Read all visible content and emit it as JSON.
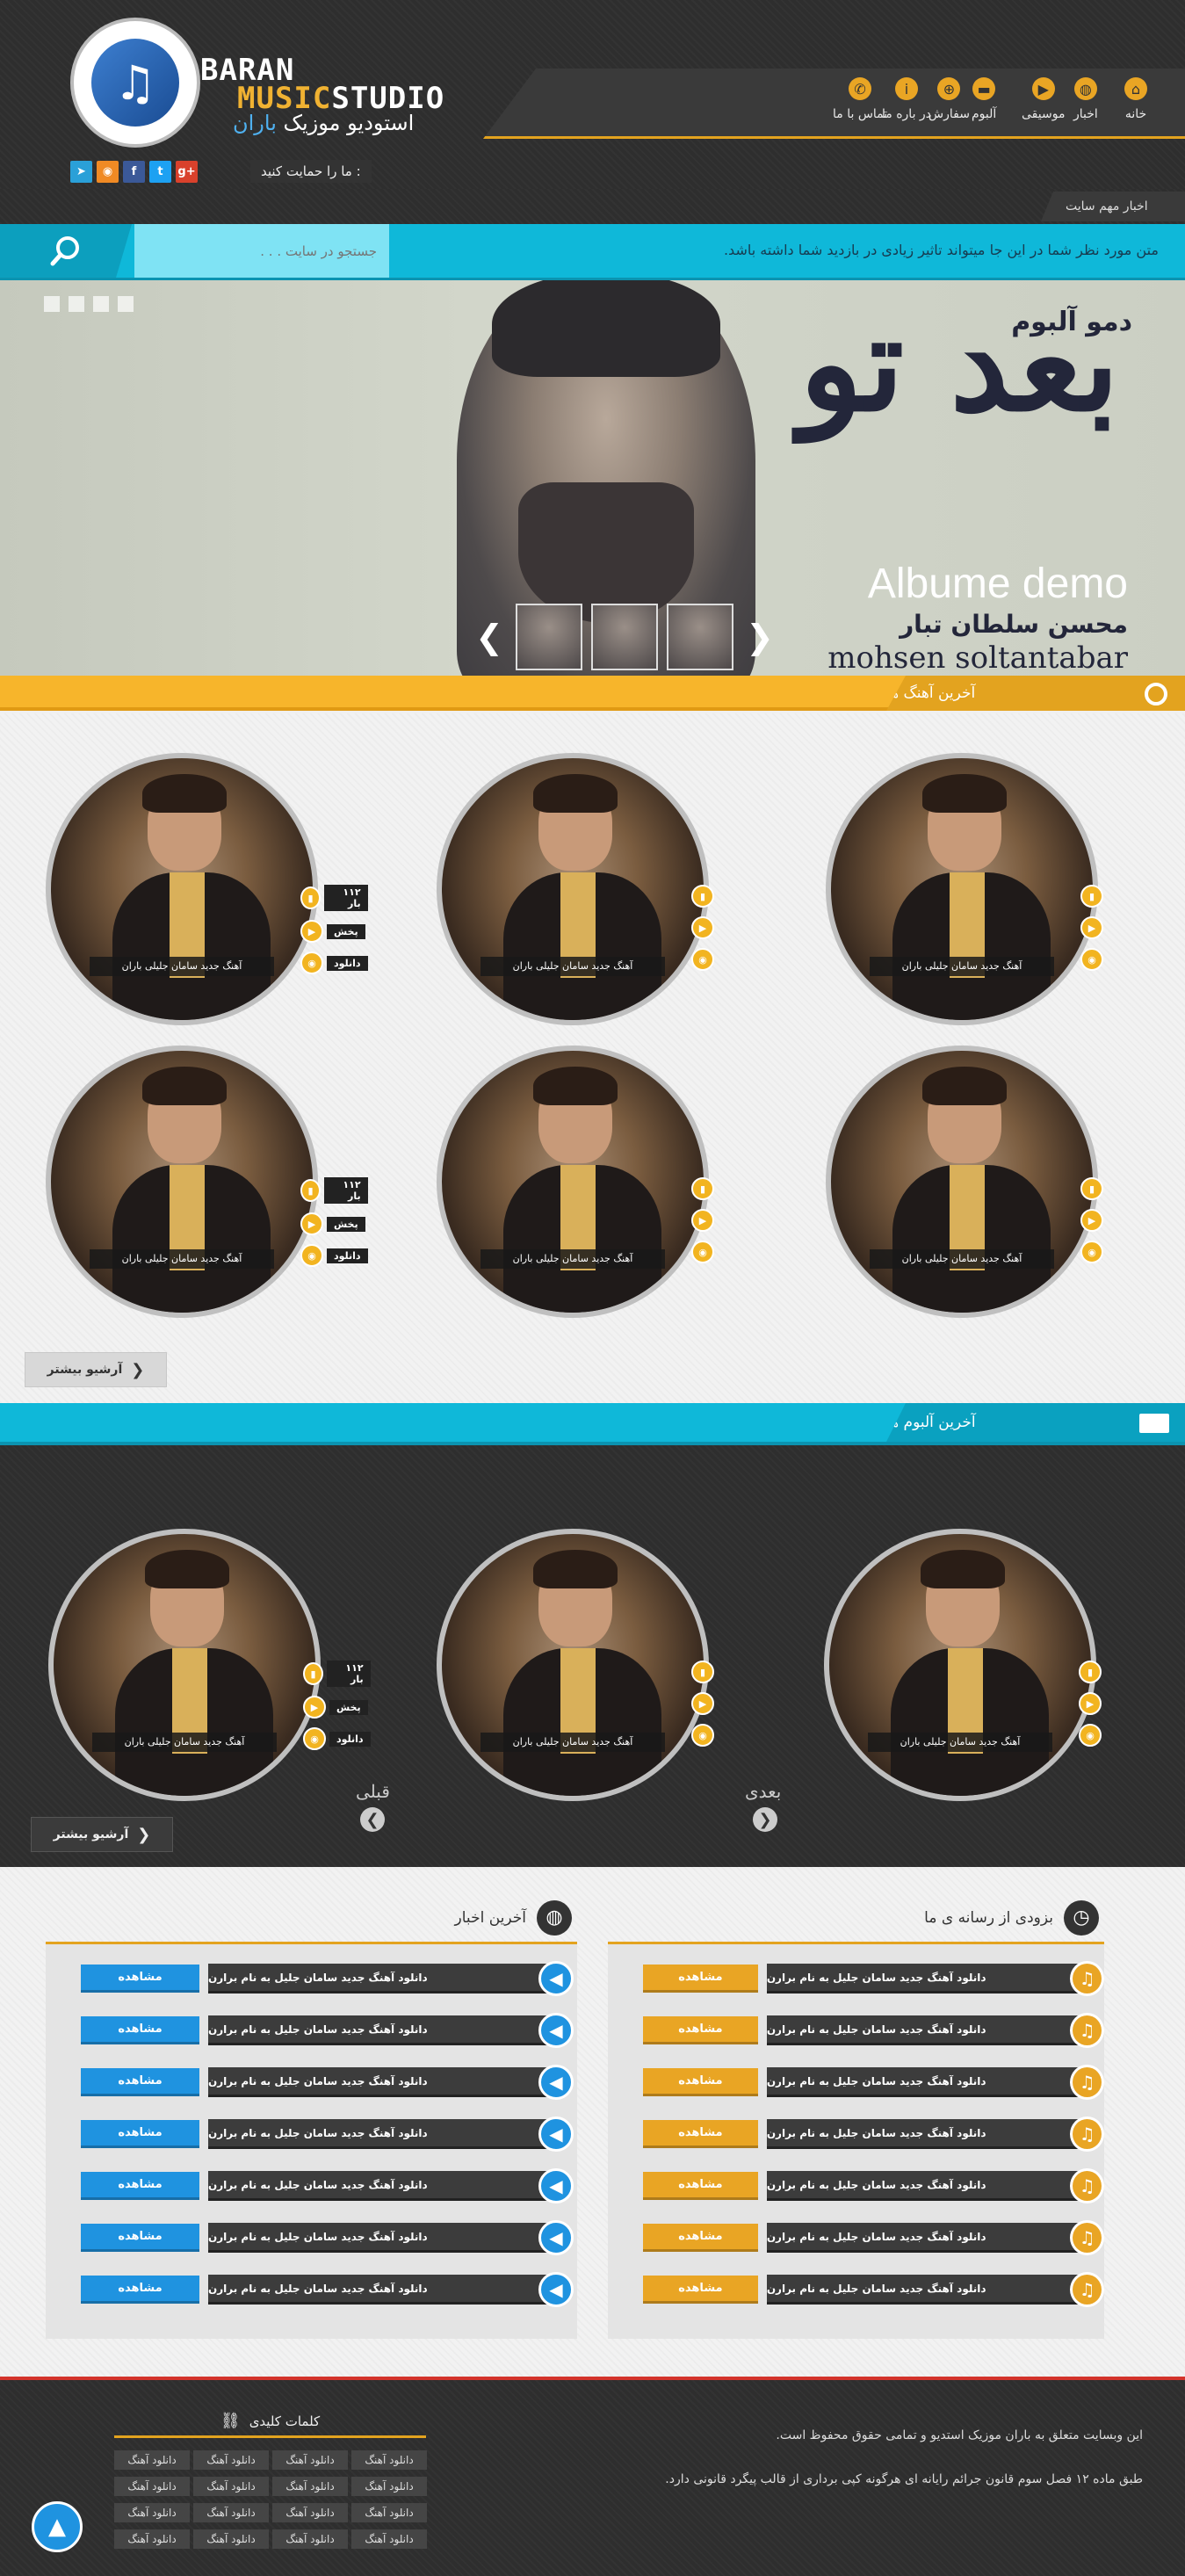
{
  "brand": {
    "en_top": "BARAN",
    "en_bottom_yellow": "MUSIC",
    "en_bottom_white": "STUDIO",
    "fa_main": "استودیو موزیک",
    "fa_accent": "باران"
  },
  "nav": [
    {
      "label": "خانه",
      "icon": "home-icon",
      "glyph": "⌂"
    },
    {
      "label": "اخبار",
      "icon": "globe-icon",
      "glyph": "◍"
    },
    {
      "label": "موسیقی",
      "icon": "play-icon",
      "glyph": "▶"
    },
    {
      "label": "آلبوم",
      "icon": "folder-icon",
      "glyph": "▬"
    },
    {
      "label": "سفارش",
      "icon": "cart-icon",
      "glyph": "⊕"
    },
    {
      "label": "در باره ما",
      "icon": "info-icon",
      "glyph": "i"
    },
    {
      "label": "تماس با ما",
      "icon": "phone-icon",
      "glyph": "✆"
    }
  ],
  "support": {
    "label": "ما را حمایت کنید :",
    "social": [
      {
        "name": "telegram-icon",
        "glyph": "➤",
        "color": "#2aa0d8"
      },
      {
        "name": "rss-icon",
        "glyph": "◉",
        "color": "#f08a24"
      },
      {
        "name": "facebook-icon",
        "glyph": "f",
        "color": "#3b5998"
      },
      {
        "name": "twitter-icon",
        "glyph": "t",
        "color": "#1da1f2"
      },
      {
        "name": "googleplus-icon",
        "glyph": "g+",
        "color": "#d9412c"
      }
    ]
  },
  "news_tag": "اخبار مهم سایت",
  "search": {
    "placeholder": "جستجو در سایت . . ."
  },
  "ticker": "متن مورد نظر شما در این جا میتواند تاثیر زیادی در بازدید شما داشته باشد.",
  "slider": {
    "album_label": "دمو آلبوم",
    "album_title": "بعد تو",
    "album_en": "Albume demo",
    "artist_fa": "محسن سلطان تبار",
    "artist_en": "mohsen soltantabar",
    "prev": "❮",
    "next": "❯"
  },
  "latest_songs": {
    "title": "آخرین آهنگ ها",
    "cards": [
      {
        "title": "آهنگ جدید سامان جلیلی باران",
        "count": "۱۱۲ بار",
        "play": "پخش",
        "download": "دانلود"
      },
      {
        "title": "آهنگ جدید سامان جلیلی باران"
      },
      {
        "title": "آهنگ جدید سامان جلیلی باران"
      },
      {
        "title": "آهنگ جدید سامان جلیلی باران",
        "count": "۱۱۲ بار",
        "play": "پخش",
        "download": "دانلود"
      },
      {
        "title": "آهنگ جدید سامان جلیلی باران"
      },
      {
        "title": "آهنگ جدید سامان جلیلی باران"
      }
    ],
    "archive": "آرشیو بیشتر"
  },
  "latest_albums": {
    "title": "آخرین آلبوم ها",
    "cards": [
      {
        "title": "آهنگ جدید سامان جلیلی باران",
        "count": "۱۱۲ بار",
        "play": "پخش",
        "download": "دانلود"
      },
      {
        "title": "آهنگ جدید سامان جلیلی باران"
      },
      {
        "title": "آهنگ جدید سامان جلیلی باران"
      }
    ],
    "prev": "قبلی",
    "next": "بعدی",
    "archive": "آرشیو بیشتر"
  },
  "news_panel": {
    "title": "آخرین اخبار",
    "see": "مشاهده",
    "items": [
      "دانلود آهنگ جدید سامان جلیل به نام برارن",
      "دانلود آهنگ جدید سامان جلیل به نام برارن",
      "دانلود آهنگ جدید سامان جلیل به نام برارن",
      "دانلود آهنگ جدید سامان جلیل به نام برارن",
      "دانلود آهنگ جدید سامان جلیل به نام برارن",
      "دانلود آهنگ جدید سامان جلیل به نام برارن",
      "دانلود آهنگ جدید سامان جلیل به نام برارن"
    ]
  },
  "soon_panel": {
    "title": "بزودی از رسانه ی ما",
    "see": "مشاهده",
    "items": [
      "دانلود آهنگ جدید سامان جلیل به نام برارن",
      "دانلود آهنگ جدید سامان جلیل به نام برارن",
      "دانلود آهنگ جدید سامان جلیل به نام برارن",
      "دانلود آهنگ جدید سامان جلیل به نام برارن",
      "دانلود آهنگ جدید سامان جلیل به نام برارن",
      "دانلود آهنگ جدید سامان جلیل به نام برارن",
      "دانلود آهنگ جدید سامان جلیل به نام برارن"
    ]
  },
  "footer": {
    "keywords_title": "کلمات کلیدی",
    "keywords": [
      "دانلود آهنگ",
      "دانلود آهنگ",
      "دانلود آهنگ",
      "دانلود آهنگ",
      "دانلود آهنگ",
      "دانلود آهنگ",
      "دانلود آهنگ",
      "دانلود آهنگ",
      "دانلود آهنگ",
      "دانلود آهنگ",
      "دانلود آهنگ",
      "دانلود آهنگ",
      "دانلود آهنگ",
      "دانلود آهنگ",
      "دانلود آهنگ",
      "دانلود آهنگ"
    ],
    "text1": "این وبسایت متعلق به باران موزیک استدیو و تمامی حقوق محفوظ است.",
    "text2": "طبق ماده ۱۲ فصل سوم قانون جرائم رایانه ای هرگونه کپی برداری از قالب پیگرد قانونی دارد."
  },
  "colors": {
    "accent": "#e3a31f",
    "cyan": "#0fb8d9",
    "blue": "#1f93e0",
    "orange": "#e9a524",
    "dark": "#2e2e2e"
  }
}
